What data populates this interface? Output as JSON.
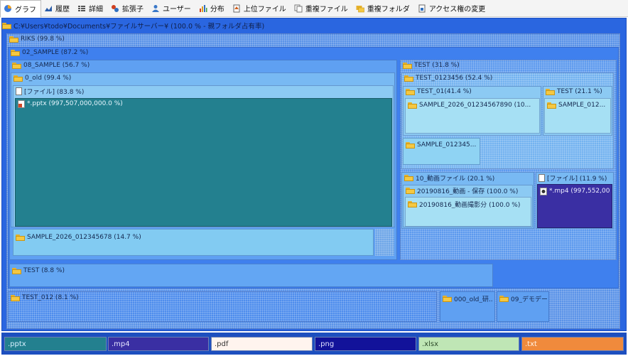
{
  "toolbar": {
    "tabs": [
      {
        "label": "グラフ",
        "icon": "pie-chart-icon",
        "active": true
      },
      {
        "label": "履歴",
        "icon": "history-icon"
      },
      {
        "label": "詳細",
        "icon": "details-list-icon"
      },
      {
        "label": "拡張子",
        "icon": "extension-icon"
      },
      {
        "label": "ユーザー",
        "icon": "user-icon"
      },
      {
        "label": "分布",
        "icon": "distribution-icon"
      },
      {
        "label": "上位ファイル",
        "icon": "top-files-icon"
      },
      {
        "label": "重複ファイル",
        "icon": "duplicate-file-icon"
      },
      {
        "label": "重複フォルダ",
        "icon": "duplicate-folder-icon"
      },
      {
        "label": "アクセス権の変更",
        "icon": "permission-icon"
      }
    ]
  },
  "treemap": {
    "path": "C:¥Users¥todo¥Documents¥ファイルサーバー¥ (100.0 % - 親フォルダ占有率)",
    "nodes": {
      "riks": "RIKS (99.8 %)",
      "sample02": "02_SAMPLE (87.2 %)",
      "sample08": "08_SAMPLE (56.7 %)",
      "old0": "0_old (99.4 %)",
      "files1": "[ファイル] (83.8 %)",
      "pptx": "*.pptx (997,507,000,000.0 %)",
      "sample2026a": "SAMPLE_2026_012345678 (14.7 %)",
      "test1": "TEST (31.8 %)",
      "test0123456": "TEST_0123456 (52.4 %)",
      "test01": "TEST_01(41.4 %)",
      "test2": "TEST (21.1 %)",
      "sample2026b": "SAMPLE_2026_01234567890 (10...",
      "sample012b": "SAMPLE_012...",
      "sample012c": "SAMPLE_012345...",
      "video10": "10_動画ファイル (20.1 %)",
      "files2": "[ファイル] (11.9 %)",
      "v20190816a": "20190816_動画 - 保存 (100.0 %)",
      "v20190816b": "20190816_動画撮影分 (100.0 %)",
      "mp4": "*.mp4 (997,552,00...",
      "test3": "TEST (8.8 %)",
      "test012": "TEST_012 (8.1 %)",
      "old000": "000_old_研...",
      "demo09": "09_デモデー..."
    }
  },
  "legend": [
    {
      "label": ".pptx",
      "color": "#23808f",
      "text": "#d8f0ff"
    },
    {
      "label": ".mp4",
      "color": "#3a2fa3",
      "text": "#e6e6ff"
    },
    {
      "label": ".pdf",
      "color": "#fff4ee",
      "text": "#333333"
    },
    {
      "label": ".png",
      "color": "#12129a",
      "text": "#e0e0ff"
    },
    {
      "label": ".xlsx",
      "color": "#bfe6b5",
      "text": "#2d4a2a"
    },
    {
      "label": ".txt",
      "color": "#f08a3c",
      "text": "#fff2e6"
    }
  ]
}
